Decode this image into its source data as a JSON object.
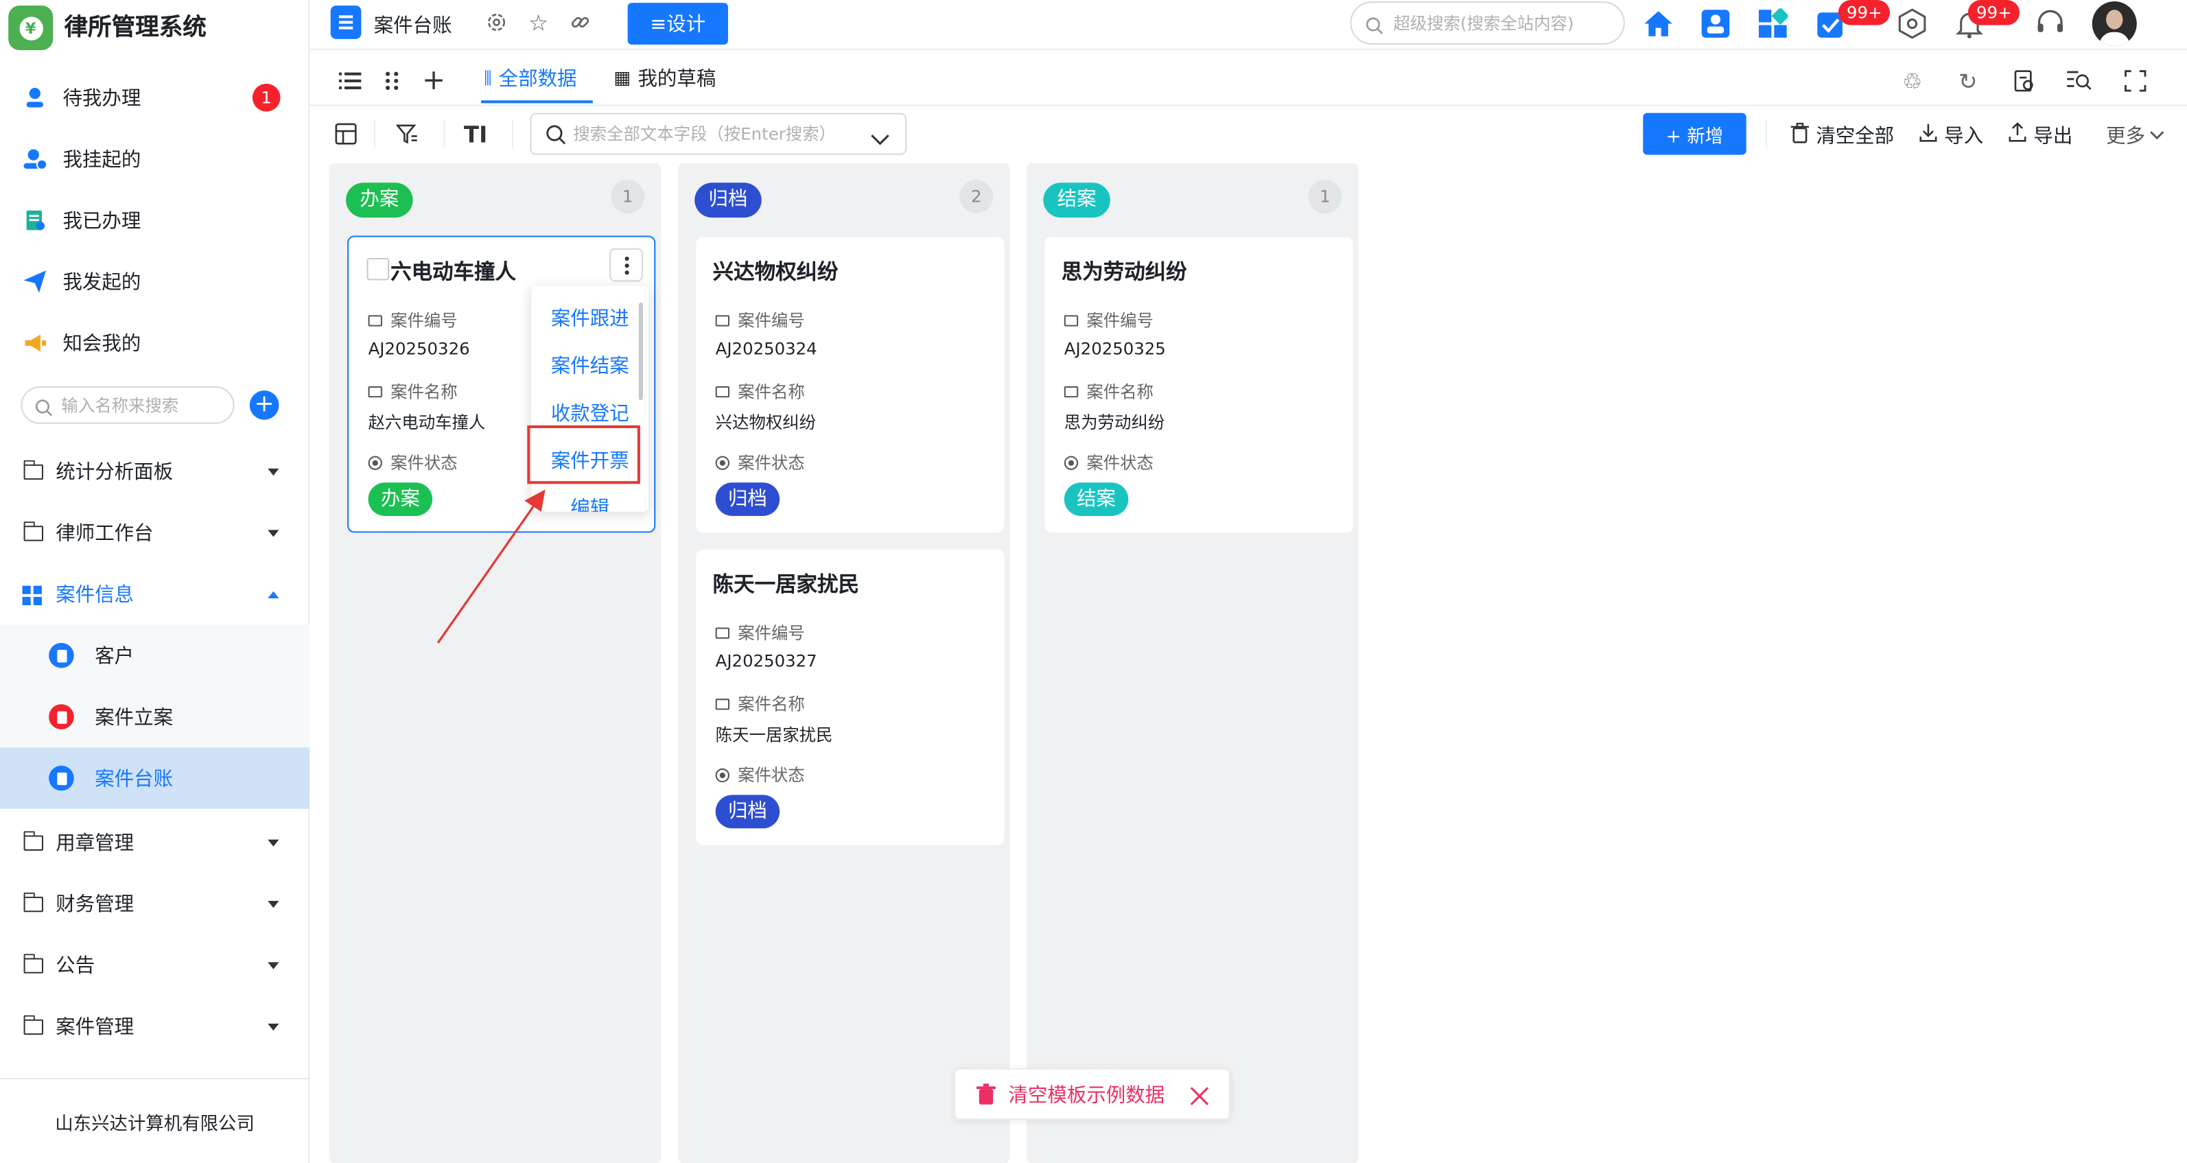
{
  "app": {
    "title": "律所管理系统"
  },
  "sidebar": {
    "top_items": [
      {
        "label": "待我办理",
        "badge": "1"
      },
      {
        "label": "我挂起的"
      },
      {
        "label": "我已办理"
      },
      {
        "label": "我发起的"
      },
      {
        "label": "知会我的"
      }
    ],
    "search_placeholder": "输入名称来搜索",
    "groups": [
      {
        "label": "统计分析面板"
      },
      {
        "label": "律师工作台"
      },
      {
        "label": "案件信息",
        "expanded": true
      }
    ],
    "sub_items": [
      {
        "label": "客户",
        "color": "#1677ff"
      },
      {
        "label": "案件立案",
        "color": "#f5222d"
      },
      {
        "label": "案件台账",
        "color": "#1677ff",
        "active": true
      }
    ],
    "groups_after": [
      {
        "label": "用章管理"
      },
      {
        "label": "财务管理"
      },
      {
        "label": "公告"
      },
      {
        "label": "案件管理"
      }
    ],
    "company": "山东兴达计算机有限公司"
  },
  "topbar": {
    "tab_title": "案件台账",
    "design_label": "≡设计",
    "search_placeholder": "超级搜索(搜索全站内容)",
    "badges": {
      "todo": "99+",
      "notify": "99+"
    }
  },
  "views": [
    {
      "label": "全部数据",
      "active": true
    },
    {
      "label": "我的草稿"
    }
  ],
  "toolbar": {
    "search_placeholder": "搜索全部文本字段（按Enter搜索）",
    "new_label": "+ 新增",
    "clear_label": "清空全部",
    "import_label": "导入",
    "export_label": "导出",
    "more_label": "更多"
  },
  "field_labels": {
    "code": "案件编号",
    "name": "案件名称",
    "status": "案件状态"
  },
  "columns": [
    {
      "title": "办案",
      "count": "1",
      "color": "#1cc052",
      "cards": [
        {
          "title": "六电动车撞人",
          "code": "AJ20250326",
          "name": "赵六电动车撞人",
          "status": "办案"
        }
      ]
    },
    {
      "title": "归档",
      "count": "2",
      "color": "#2e4ed1",
      "cards": [
        {
          "title": "兴达物权纠纷",
          "code": "AJ20250324",
          "name": "兴达物权纠纷",
          "status": "归档"
        },
        {
          "title": "陈天一居家扰民",
          "code": "AJ20250327",
          "name": "陈天一居家扰民",
          "status": "归档"
        }
      ]
    },
    {
      "title": "结案",
      "count": "1",
      "color": "#19c4c0",
      "cards": [
        {
          "title": "思为劳动纠纷",
          "code": "AJ20250325",
          "name": "思为劳动纠纷",
          "status": "结案"
        }
      ]
    }
  ],
  "dropdown": {
    "items": [
      "案件跟进",
      "案件结案",
      "收款登记",
      "案件开票",
      "编辑"
    ],
    "highlighted": "案件开票"
  },
  "toast": {
    "label": "清空模板示例数据"
  }
}
